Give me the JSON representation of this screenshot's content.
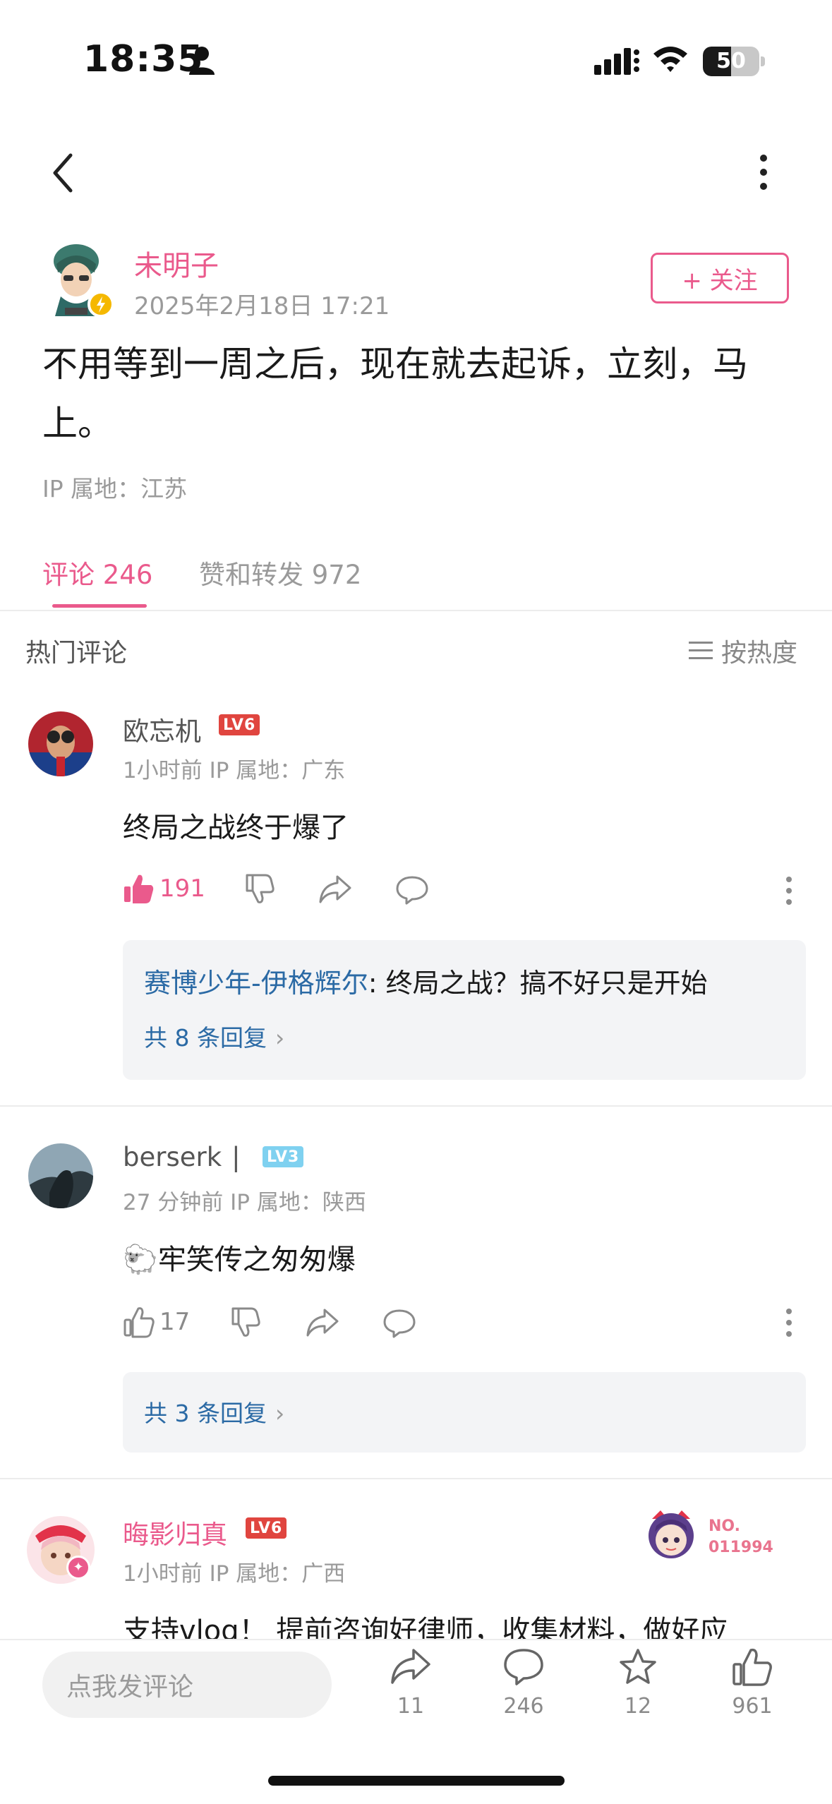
{
  "status_bar": {
    "time": "18:35",
    "battery": "50",
    "battery_level": 0.5
  },
  "post": {
    "author": "未明子",
    "date": "2025年2月18日 17:21",
    "follow_label": "+ 关注",
    "text": "不用等到一周之后，现在就去起诉，立刻，马上。",
    "ip": "IP 属地：江苏"
  },
  "tabs": [
    {
      "label": "评论 246",
      "active": true
    },
    {
      "label": "赞和转发 972",
      "active": false
    }
  ],
  "hot_section": {
    "title": "热门评论",
    "sort_label": "按热度"
  },
  "comments": [
    {
      "name": "欧忘机",
      "level": "LV6",
      "meta": "1小时前  IP 属地：广东",
      "text": "终局之战终于爆了",
      "likes": "191",
      "liked": true,
      "reply": {
        "name": "赛博少年-伊格辉尔",
        "text": ": 终局之战？搞不好只是开始"
      },
      "reply_count": "共 8 条回复"
    },
    {
      "name": "berserk",
      "level": "LV3",
      "meta": "27 分钟前  IP 属地：陕西",
      "text": "牢笑传之匆匆爆",
      "emoji": "🐑",
      "likes": "17",
      "liked": false,
      "reply_count": "共 3 条回复"
    },
    {
      "name": "晦影归真",
      "level": "LV6",
      "meta": "1小时前  IP 属地：广西",
      "text": "支持vlog！ 提前咨询好律师，收集材料，做好应",
      "badge_number": "NO.\n011994"
    }
  ],
  "bottom_bar": {
    "input_placeholder": "点我发评论",
    "share_count": "11",
    "comment_count": "246",
    "favorite_count": "12",
    "like_count": "961"
  },
  "colors": {
    "accent": "#ea5a8c",
    "link": "#2b6aa5",
    "lv_red": "#e0453f",
    "lv_blue": "#7fd1f0"
  }
}
